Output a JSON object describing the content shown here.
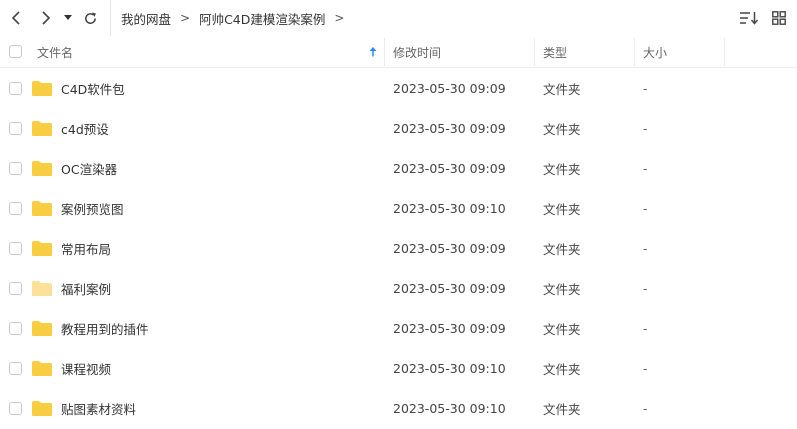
{
  "breadcrumb": {
    "root": "我的网盘",
    "current": "阿帅C4D建模渲染案例",
    "separator": ">"
  },
  "columns": {
    "name": "文件名",
    "modified": "修改时间",
    "type": "类型",
    "size": "大小"
  },
  "icons": {
    "back": "chevron-left-icon",
    "forward": "chevron-right-icon",
    "history": "caret-down-icon",
    "refresh": "refresh-icon",
    "sort": "sort-list-icon",
    "view": "grid-view-icon",
    "folder": "folder-icon"
  },
  "colors": {
    "folder": "#f9cd41",
    "folder_light": "#fbe19a",
    "sort_arrow": "#2b8cf7"
  },
  "files": [
    {
      "name": "C4D软件包",
      "modified": "2023-05-30 09:09",
      "type": "文件夹",
      "size": "-",
      "folder_style": "normal"
    },
    {
      "name": "c4d预设",
      "modified": "2023-05-30 09:09",
      "type": "文件夹",
      "size": "-",
      "folder_style": "normal"
    },
    {
      "name": "OC渲染器",
      "modified": "2023-05-30 09:09",
      "type": "文件夹",
      "size": "-",
      "folder_style": "normal"
    },
    {
      "name": "案例预览图",
      "modified": "2023-05-30 09:10",
      "type": "文件夹",
      "size": "-",
      "folder_style": "normal"
    },
    {
      "name": "常用布局",
      "modified": "2023-05-30 09:09",
      "type": "文件夹",
      "size": "-",
      "folder_style": "normal"
    },
    {
      "name": "福利案例",
      "modified": "2023-05-30 09:09",
      "type": "文件夹",
      "size": "-",
      "folder_style": "light"
    },
    {
      "name": "教程用到的插件",
      "modified": "2023-05-30 09:09",
      "type": "文件夹",
      "size": "-",
      "folder_style": "normal"
    },
    {
      "name": "课程视频",
      "modified": "2023-05-30 09:10",
      "type": "文件夹",
      "size": "-",
      "folder_style": "normal"
    },
    {
      "name": "贴图素材资料",
      "modified": "2023-05-30 09:10",
      "type": "文件夹",
      "size": "-",
      "folder_style": "normal"
    }
  ]
}
